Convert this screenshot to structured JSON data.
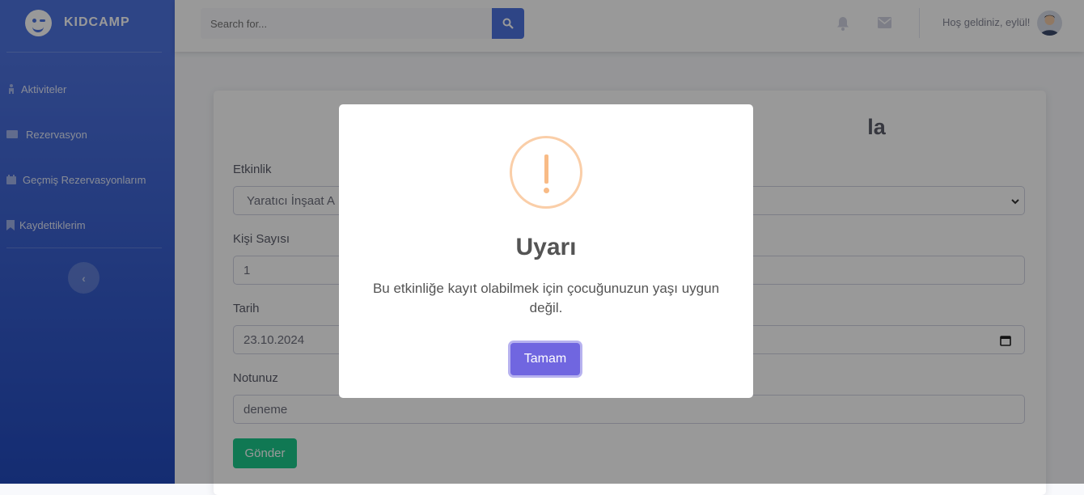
{
  "brand": {
    "name": "KIDCAMP",
    "icon": "smile-icon"
  },
  "sidebar": {
    "items": [
      {
        "label": "Aktiviteler",
        "icon": "child-icon"
      },
      {
        "label": "Rezervasyon",
        "icon": "ticket-icon"
      },
      {
        "label": "Geçmiş Rezervasyonlarım",
        "icon": "calendar-icon"
      },
      {
        "label": "Kaydettiklerim",
        "icon": "bookmark-icon"
      }
    ],
    "toggle_label": "‹"
  },
  "topbar": {
    "search_placeholder": "Search for...",
    "welcome": "Hoş geldiniz, eylül!"
  },
  "form": {
    "title_visible": "la",
    "labels": {
      "activity": "Etkinlik",
      "people": "Kişi Sayısı",
      "date": "Tarih",
      "note": "Notunuz"
    },
    "values": {
      "activity": "Yaratıcı İnşaat A",
      "people": "1",
      "date": "23.10.2024",
      "note": "deneme"
    },
    "submit_label": "Gönder"
  },
  "modal": {
    "icon": "warning-icon",
    "title": "Uyarı",
    "text": "Bu etkinliğe kayıt olabilmek için çocuğunuzun yaşı uygun değil.",
    "ok_label": "Tamam"
  }
}
